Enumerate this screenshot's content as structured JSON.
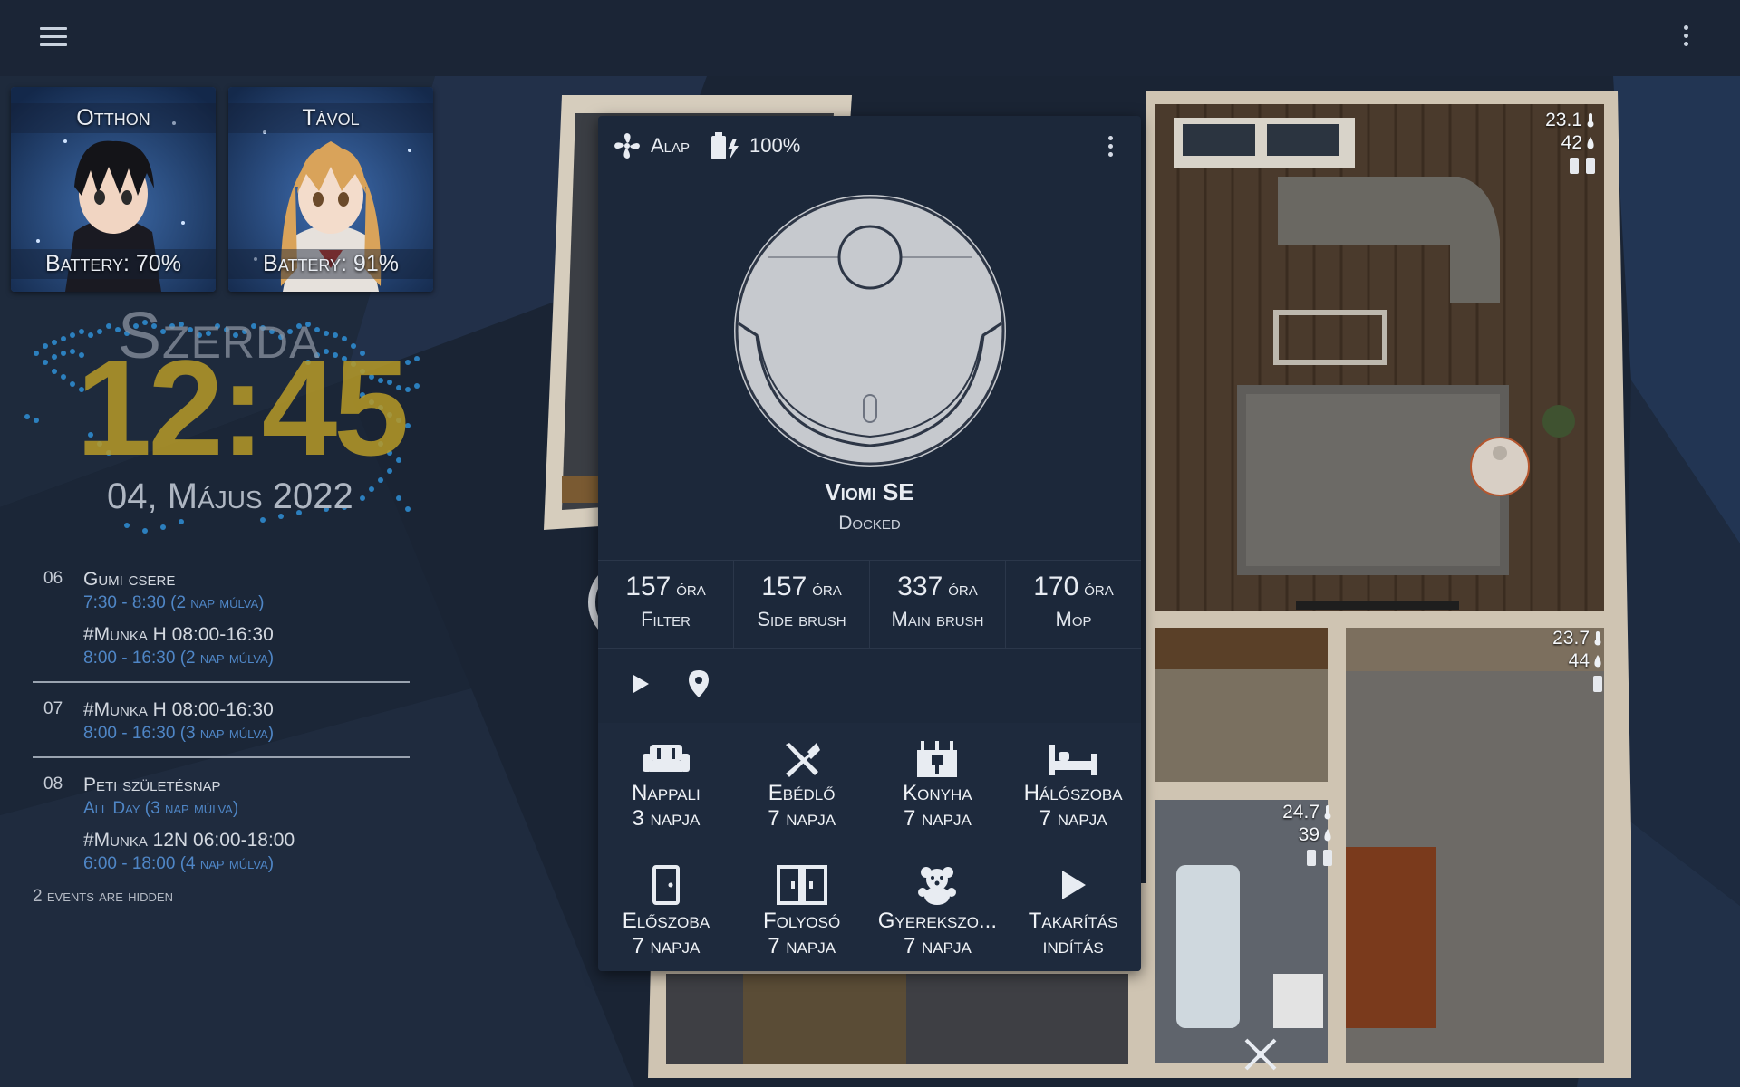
{
  "persons": [
    {
      "name": "Otthon",
      "battery": "Battery: 70%"
    },
    {
      "name": "Távol",
      "battery": "Battery: 91%"
    }
  ],
  "clock": {
    "day": "Szerda",
    "time": "12:45",
    "date": "04, Május 2022"
  },
  "calendar": {
    "days": [
      {
        "day": "06",
        "events": [
          {
            "title": "Gumi csere",
            "meta": "7:30 - 8:30 (2 nap múlva)"
          },
          {
            "title": "#Munka H 08:00-16:30",
            "meta": "8:00 - 16:30  (2 nap múlva)"
          }
        ]
      },
      {
        "day": "07",
        "events": [
          {
            "title": "#Munka H 08:00-16:30",
            "meta": "8:00 - 16:30  (3 nap múlva)"
          }
        ]
      },
      {
        "day": "08",
        "events": [
          {
            "title": "Peti születésnap",
            "meta": "All Day  (3 nap múlva)"
          },
          {
            "title": "#Munka 12N 06:00-18:00",
            "meta": "6:00 - 18:00     (4 nap múlva)"
          }
        ]
      }
    ],
    "hidden_note": "2 events are hidden"
  },
  "vacuum": {
    "fan_mode": "Alap",
    "battery": "100%",
    "name": "Viomi SE",
    "status": "Docked",
    "stats": [
      {
        "value": "157",
        "unit": "óra",
        "label": "Filter"
      },
      {
        "value": "157",
        "unit": "óra",
        "label": "Side brush"
      },
      {
        "value": "337",
        "unit": "óra",
        "label": "Main brush"
      },
      {
        "value": "170",
        "unit": "óra",
        "label": "Mop"
      }
    ],
    "rooms": [
      {
        "name": "Nappali",
        "days": "3 napja",
        "icon": "sofa-icon"
      },
      {
        "name": "Ebédlő",
        "days": "7 napja",
        "icon": "fork-knife-icon"
      },
      {
        "name": "Konyha",
        "days": "7 napja",
        "icon": "stove-icon"
      },
      {
        "name": "Hálószoba",
        "days": "7 napja",
        "icon": "bed-icon"
      },
      {
        "name": "Előszoba",
        "days": "7 napja",
        "icon": "door-icon"
      },
      {
        "name": "Folyosó",
        "days": "7 napja",
        "icon": "double-door-icon"
      },
      {
        "name": "Gyerekszo...",
        "days": "7 napja",
        "icon": "teddy-bear-icon"
      },
      {
        "name": "Takarítás",
        "days": "indítás",
        "icon": "play-icon"
      }
    ]
  },
  "sensors": [
    {
      "temp": "23.1",
      "hum": "42"
    },
    {
      "temp": "23.7",
      "hum": "44"
    },
    {
      "temp": "24.7",
      "hum": "39"
    }
  ],
  "colors": {
    "accent_gold": "#b79a27",
    "event_blue": "#4f86c6",
    "card_bg": "#1c283a"
  }
}
